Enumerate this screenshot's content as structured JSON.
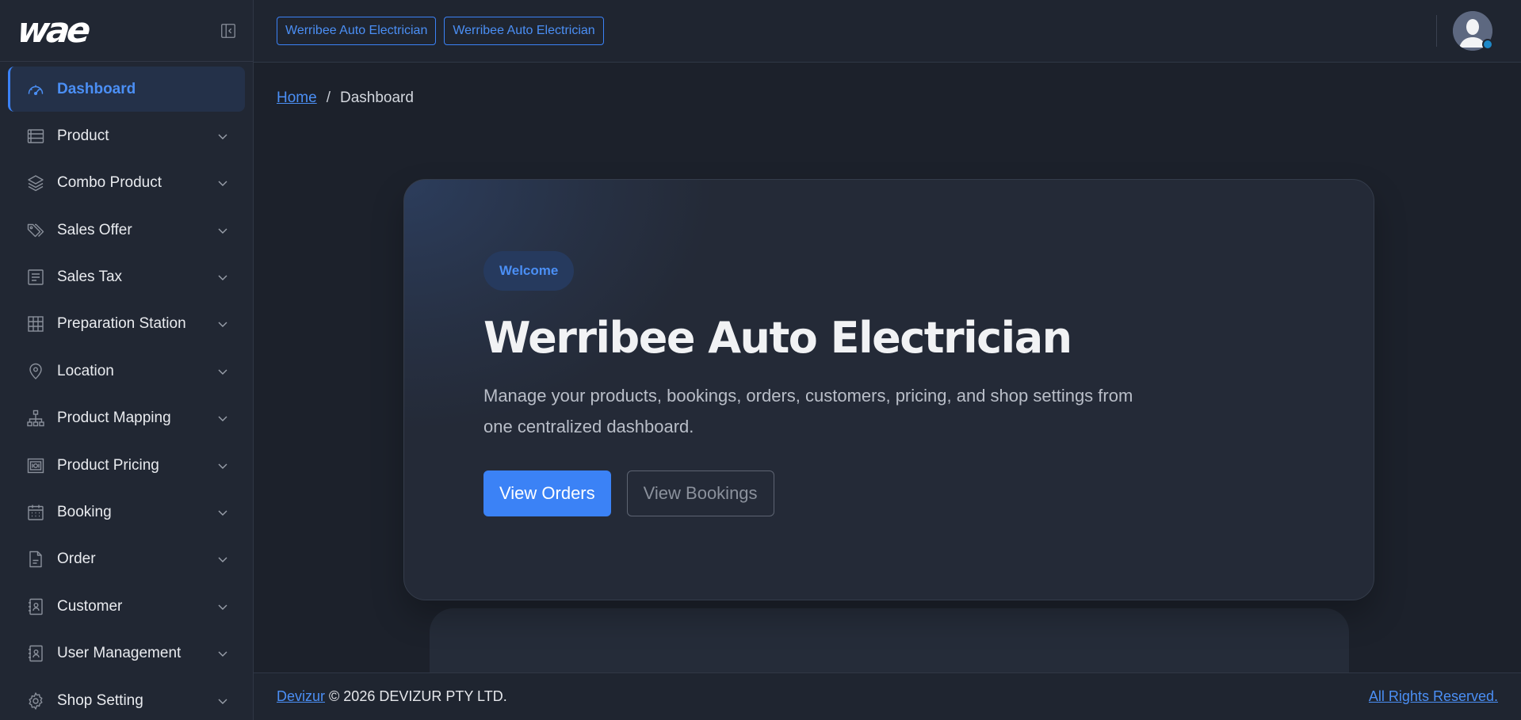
{
  "brand": {
    "logo_text": "wae"
  },
  "sidebar": {
    "items": [
      {
        "label": "Dashboard",
        "icon": "dashboard-icon",
        "active": true
      },
      {
        "label": "Product",
        "icon": "product-icon"
      },
      {
        "label": "Combo Product",
        "icon": "layers-icon"
      },
      {
        "label": "Sales Offer",
        "icon": "tags-icon"
      },
      {
        "label": "Sales Tax",
        "icon": "document-list-icon"
      },
      {
        "label": "Preparation Station",
        "icon": "grid-icon"
      },
      {
        "label": "Location",
        "icon": "map-pin-icon"
      },
      {
        "label": "Product Mapping",
        "icon": "hierarchy-icon"
      },
      {
        "label": "Product Pricing",
        "icon": "pricing-icon"
      },
      {
        "label": "Booking",
        "icon": "calendar-icon"
      },
      {
        "label": "Order",
        "icon": "file-icon"
      },
      {
        "label": "Customer",
        "icon": "contact-book-icon"
      },
      {
        "label": "User Management",
        "icon": "user-book-icon"
      },
      {
        "label": "Shop Setting",
        "icon": "gear-icon"
      }
    ]
  },
  "topbar": {
    "chips": [
      "Werribee Auto Electrician",
      "Werribee Auto Electrician"
    ]
  },
  "breadcrumb": {
    "home": "Home",
    "separator": "/",
    "current": "Dashboard"
  },
  "hero": {
    "badge": "Welcome",
    "title": "Werribee Auto Electrician",
    "description": "Manage your products, bookings, orders, customers, pricing, and shop settings from one centralized dashboard.",
    "primary_button": "View Orders",
    "secondary_button": "View Bookings"
  },
  "footer": {
    "link": "Devizur",
    "copyright": "© 2026 DEVIZUR PTY LTD.",
    "rights": "All Rights Reserved."
  },
  "colors": {
    "accent": "#3b82f6",
    "sidebar_bg": "#212733",
    "page_bg": "#1c212b",
    "status_online": "#1e88c7"
  }
}
